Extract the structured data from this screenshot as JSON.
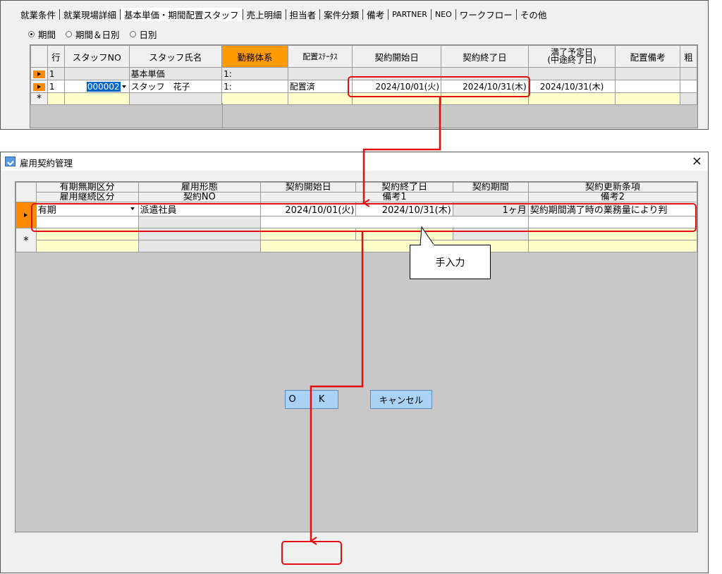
{
  "top_window": {
    "tabs": [
      "就業条件",
      "就業現場詳細",
      "基本単価・期間配置スタッフ",
      "売上明細",
      "担当者",
      "案件分類",
      "備考",
      "PARTNER",
      "NEO",
      "ワークフロー",
      "その他"
    ],
    "active_tab": "基本単価・期間配置スタッフ",
    "radio_options": [
      "期間",
      "期間＆日別",
      "日別"
    ],
    "radio_selected": "期間",
    "grid": {
      "columns": [
        "行",
        "スタッフNO",
        "スタッフ氏名",
        "勤務体系",
        "配置ｽﾃｰﾀｽ",
        "契約開始日",
        "契約終了日",
        "満了予定日\n(中途終了日)",
        "配置備考",
        "粗"
      ],
      "highlight_column": "勤務体系",
      "rows": [
        {
          "row": "1",
          "staff_no": "",
          "staff_name": "基本単価",
          "work_pattern": "1:",
          "status": "",
          "start": "",
          "end": "",
          "expiry": "",
          "note": ""
        },
        {
          "row": "1",
          "staff_no": "000002",
          "staff_name": "スタッフ　花子",
          "work_pattern": "1:",
          "status": "配置済",
          "start": "2024/10/01(火)",
          "end": "2024/10/31(木)",
          "expiry": "2024/10/31(木)",
          "note": ""
        }
      ],
      "new_row_marker": "*"
    }
  },
  "dialog": {
    "title": "雇用契約管理",
    "close_glyph": "×",
    "header_row1": [
      "有期無期区分",
      "雇用形態",
      "契約開始日",
      "契約終了日",
      "契約期間",
      "契約更新条項"
    ],
    "header_row2": [
      "雇用継続区分",
      "契約NO",
      "備考1",
      "備考2"
    ],
    "row": {
      "fixed_term": "有期",
      "employment_type": "派遣社員",
      "start": "2024/10/01(火)",
      "end": "2024/10/31(木)",
      "period": "1ヶ月",
      "renewal_clause": "契約期間満了時の業務量により判"
    },
    "new_row_marker": "*",
    "ok_label": "O K",
    "cancel_label": "キャンセル"
  },
  "annotation": {
    "callout_text": "手入力",
    "color": "#e01010"
  },
  "colors": {
    "orange_header": "#ff9a00",
    "yellow_row": "#ffffcc",
    "button_blue": "#a9d2f5"
  }
}
